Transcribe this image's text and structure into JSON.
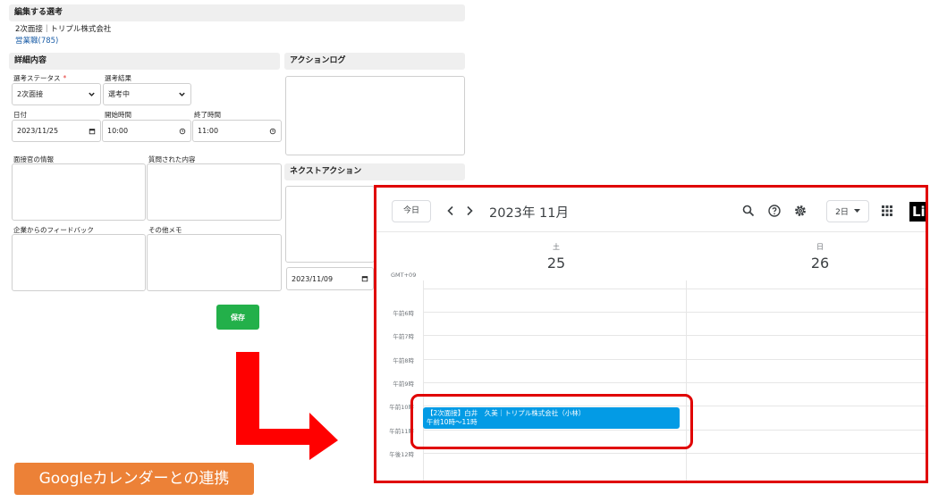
{
  "form": {
    "selection_section": {
      "heading": "編集する選考",
      "line1": "2次面接｜トリプル株式会社",
      "link": "営業職(785)"
    },
    "details_section": {
      "heading": "詳細内容",
      "status": {
        "label": "選考ステータス",
        "required_mark": "*",
        "value": "2次面接"
      },
      "result": {
        "label": "選考結果",
        "value": "選考中"
      },
      "date": {
        "label": "日付",
        "value": "2023/11/25"
      },
      "start_time": {
        "label": "開始時間",
        "value": "10:00"
      },
      "end_time": {
        "label": "終了時間",
        "value": "11:00"
      },
      "interviewer_info": {
        "label": "面接官の情報"
      },
      "questions": {
        "label": "質問された内容"
      },
      "feedback": {
        "label": "企業からのフィードバック"
      },
      "other_memo": {
        "label": "その他メモ"
      }
    },
    "action_log": {
      "heading": "アクションログ"
    },
    "next_action": {
      "heading": "ネクストアクション",
      "date_value": "2023/11/09"
    },
    "save_label": "保存"
  },
  "caption": "Googleカレンダーとの連携",
  "calendar": {
    "today_label": "今日",
    "month_label": "2023年 11月",
    "view_label": "2日",
    "logo_text": "Li",
    "timezone": "GMT+09",
    "days": [
      {
        "dow": "土",
        "num": "25"
      },
      {
        "dow": "日",
        "num": "26"
      }
    ],
    "time_labels": [
      "午前6時",
      "午前7時",
      "午前8時",
      "午前9時",
      "午前10時",
      "午前11時",
      "午後12時"
    ],
    "event": {
      "title": "【2次面接】白井　久美｜トリプル株式会社（小林）",
      "time": "午前10時～11時",
      "color": "#039be5"
    }
  },
  "colors": {
    "save_button": "#23b04a",
    "highlight_red": "#e00000",
    "arrow_red": "#ff0000",
    "caption_orange": "#ec8137",
    "link_blue": "#1d5fa8"
  }
}
